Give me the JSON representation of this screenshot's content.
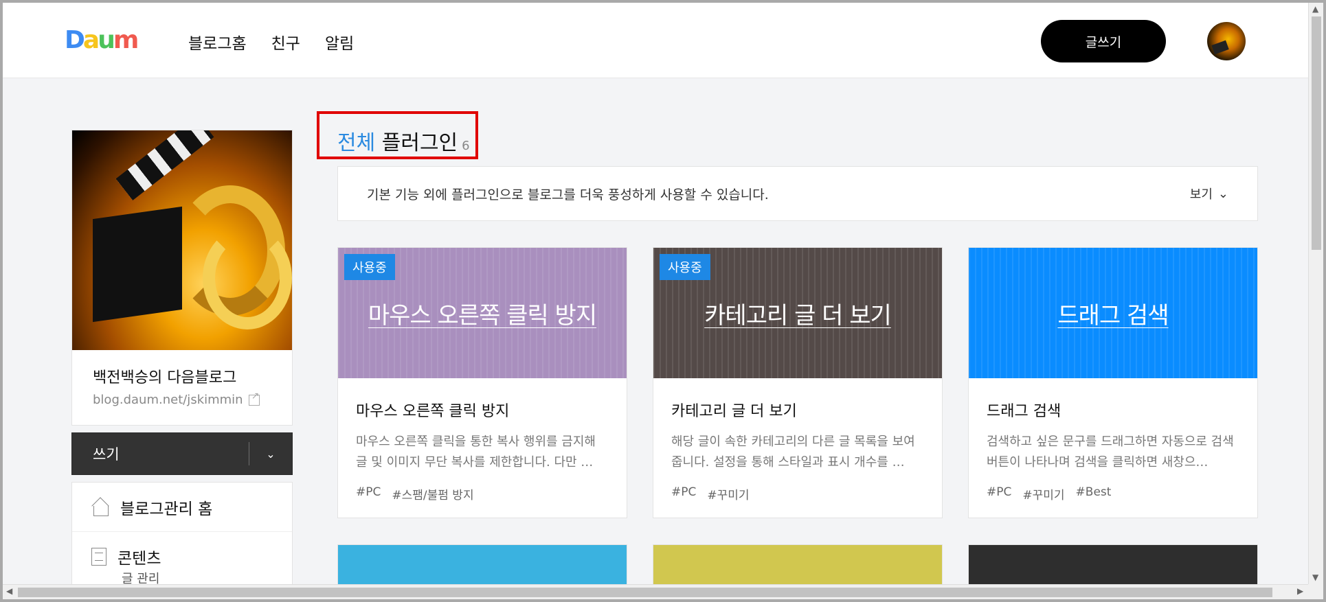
{
  "header": {
    "logo": [
      "D",
      "a",
      "u",
      "m"
    ],
    "nav": [
      "블로그홈",
      "친구",
      "알림"
    ],
    "write_label": "글쓰기"
  },
  "sidebar": {
    "blog_name": "백전백승의 다음블로그",
    "blog_url": "blog.daum.net/jskimmin",
    "write_label": "쓰기",
    "menu": [
      {
        "label": "블로그관리 홈",
        "icon": "home-icon"
      },
      {
        "label": "콘텐츠",
        "icon": "document-icon"
      }
    ],
    "sub_item": "글 관리"
  },
  "main": {
    "title_accent": "전체",
    "title_rest": " 플러그인",
    "title_count": "6",
    "description": "기본 기능 외에 플러그인으로 블로그를 더욱 풍성하게 사용할 수 있습니다.",
    "view_label": "보기",
    "cards": [
      {
        "badge": "사용중",
        "thumb_title": "마우스 오른쪽 클릭 방지",
        "thumb_color": "#a98fbe",
        "title": "마우스 오른쪽 클릭 방지",
        "desc": "마우스 오른쪽 클릭을 통한 복사 행위를 금지해 글 및 이미지 무단 복사를 제한합니다. 다만 …",
        "tags": [
          "#PC",
          "#스팸/불펌 방지"
        ]
      },
      {
        "badge": "사용중",
        "thumb_title": "카테고리 글 더 보기",
        "thumb_color": "#544a48",
        "title": "카테고리 글 더 보기",
        "desc": "해당 글이 속한 카테고리의 다른 글 목록을 보여줍니다. 설정을 통해 스타일과 표시 개수를 …",
        "tags": [
          "#PC",
          "#꾸미기"
        ]
      },
      {
        "badge": "",
        "thumb_title": "드래그 검색",
        "thumb_color": "#0a8cff",
        "title": "드래그 검색",
        "desc": "검색하고 싶은 문구를 드래그하면 자동으로 검색 버튼이 나타나며 검색을 클릭하면 새창으…",
        "tags": [
          "#PC",
          "#꾸미기",
          "#Best"
        ]
      }
    ],
    "bottom_card_colors": [
      "#3ab2e0",
      "#d1c74f",
      "#2e2e2e"
    ]
  },
  "colors": {
    "accent": "#2a8ae0",
    "badge": "#1e88e5",
    "highlight_box": "#e00000"
  }
}
